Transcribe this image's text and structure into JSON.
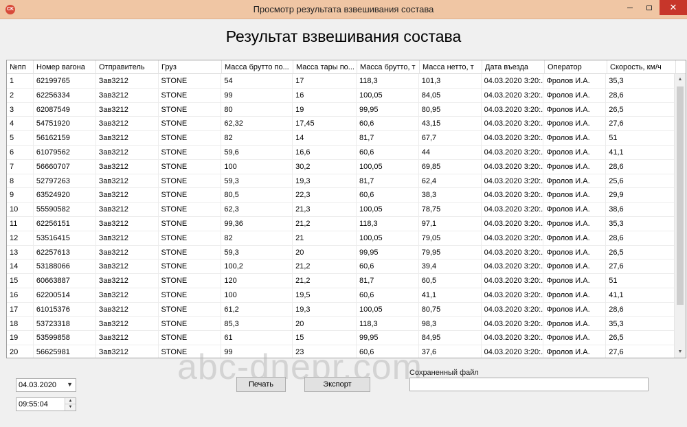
{
  "window": {
    "title": "Просмотр результата взвешивания состава",
    "icon": "app-icon",
    "icon_text": "CK"
  },
  "heading": "Результат взвешивания состава",
  "table": {
    "columns": [
      "№пп",
      "Номер вагона",
      "Отправитель",
      "Груз",
      "Масса брутто по...",
      "Масса тары по...",
      "Масса брутто, т",
      "Масса нетто, т",
      "Дата въезда",
      "Оператор",
      "Скорость, км/ч"
    ],
    "rows": [
      [
        "1",
        "62199765",
        "Зав3212",
        "STONE",
        "54",
        "17",
        "118,3",
        "101,3",
        "04.03.2020 3:20:...",
        "Фролов И.А.",
        "35,3"
      ],
      [
        "2",
        "62256334",
        "Зав3212",
        "STONE",
        "99",
        "16",
        "100,05",
        "84,05",
        "04.03.2020 3:20:...",
        "Фролов И.А.",
        "28,6"
      ],
      [
        "3",
        "62087549",
        "Зав3212",
        "STONE",
        "80",
        "19",
        "99,95",
        "80,95",
        "04.03.2020 3:20:...",
        "Фролов И.А.",
        "26,5"
      ],
      [
        "4",
        "54751920",
        "Зав3212",
        "STONE",
        "62,32",
        "17,45",
        "60,6",
        "43,15",
        "04.03.2020 3:20:...",
        "Фролов И.А.",
        "27,6"
      ],
      [
        "5",
        "56162159",
        "Зав3212",
        "STONE",
        "82",
        "14",
        "81,7",
        "67,7",
        "04.03.2020 3:20:...",
        "Фролов И.А.",
        "51"
      ],
      [
        "6",
        "61079562",
        "Зав3212",
        "STONE",
        "59,6",
        "16,6",
        "60,6",
        "44",
        "04.03.2020 3:20:...",
        "Фролов И.А.",
        "41,1"
      ],
      [
        "7",
        "56660707",
        "Зав3212",
        "STONE",
        "100",
        "30,2",
        "100,05",
        "69,85",
        "04.03.2020 3:20:...",
        "Фролов И.А.",
        "28,6"
      ],
      [
        "8",
        "52797263",
        "Зав3212",
        "STONE",
        "59,3",
        "19,3",
        "81,7",
        "62,4",
        "04.03.2020 3:20:...",
        "Фролов И.А.",
        "25,6"
      ],
      [
        "9",
        "63524920",
        "Зав3212",
        "STONE",
        "80,5",
        "22,3",
        "60,6",
        "38,3",
        "04.03.2020 3:20:...",
        "Фролов И.А.",
        "29,9"
      ],
      [
        "10",
        "55590582",
        "Зав3212",
        "STONE",
        "62,3",
        "21,3",
        "100,05",
        "78,75",
        "04.03.2020 3:20:...",
        "Фролов И.А.",
        "38,6"
      ],
      [
        "11",
        "62256151",
        "Зав3212",
        "STONE",
        "99,36",
        "21,2",
        "118,3",
        "97,1",
        "04.03.2020 3:20:...",
        "Фролов И.А.",
        "35,3"
      ],
      [
        "12",
        "53516415",
        "Зав3212",
        "STONE",
        "82",
        "21",
        "100,05",
        "79,05",
        "04.03.2020 3:20:...",
        "Фролов И.А.",
        "28,6"
      ],
      [
        "13",
        "62257613",
        "Зав3212",
        "STONE",
        "59,3",
        "20",
        "99,95",
        "79,95",
        "04.03.2020 3:20:...",
        "Фролов И.А.",
        "26,5"
      ],
      [
        "14",
        "53188066",
        "Зав3212",
        "STONE",
        "100,2",
        "21,2",
        "60,6",
        "39,4",
        "04.03.2020 3:20:...",
        "Фролов И.А.",
        "27,6"
      ],
      [
        "15",
        "60663887",
        "Зав3212",
        "STONE",
        "120",
        "21,2",
        "81,7",
        "60,5",
        "04.03.2020 3:20:...",
        "Фролов И.А.",
        "51"
      ],
      [
        "16",
        "62200514",
        "Зав3212",
        "STONE",
        "100",
        "19,5",
        "60,6",
        "41,1",
        "04.03.2020 3:20:...",
        "Фролов И.А.",
        "41,1"
      ],
      [
        "17",
        "61015376",
        "Зав3212",
        "STONE",
        "61,2",
        "19,3",
        "100,05",
        "80,75",
        "04.03.2020 3:20:...",
        "Фролов И.А.",
        "28,6"
      ],
      [
        "18",
        "53723318",
        "Зав3212",
        "STONE",
        "85,3",
        "20",
        "118,3",
        "98,3",
        "04.03.2020 3:20:...",
        "Фролов И.А.",
        "35,3"
      ],
      [
        "19",
        "53599858",
        "Зав3212",
        "STONE",
        "61",
        "15",
        "99,95",
        "84,95",
        "04.03.2020 3:20:...",
        "Фролов И.А.",
        "26,5"
      ],
      [
        "20",
        "56625981",
        "Зав3212",
        "STONE",
        "99",
        "23",
        "60,6",
        "37,6",
        "04.03.2020 3:20:...",
        "Фролов И.А.",
        "27,6"
      ]
    ]
  },
  "controls": {
    "date_value": "04.03.2020",
    "time_value": "09:55:04",
    "print_label": "Печать",
    "export_label": "Экспорт",
    "saved_file_label": "Сохраненный файл",
    "saved_file_value": ""
  },
  "watermark": "abc-dnepr.com",
  "colors": {
    "titlebar": "#f0c6a4",
    "close_button": "#c7362a",
    "window_bg": "#f0f0f0"
  }
}
